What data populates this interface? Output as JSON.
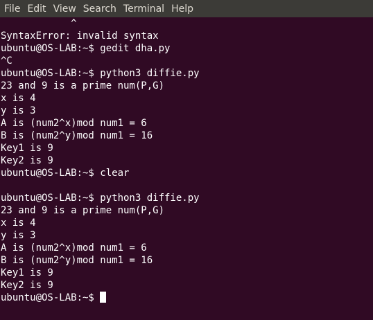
{
  "menu": [
    "File",
    "Edit",
    "View",
    "Search",
    "Terminal",
    "Help"
  ],
  "terminal": {
    "lines": [
      "            ^",
      "SyntaxError: invalid syntax",
      "ubuntu@OS-LAB:~$ gedit dha.py",
      "^C",
      "ubuntu@OS-LAB:~$ python3 diffie.py",
      "23 and 9 is a prime num(P,G)",
      "x is 4",
      "y is 3",
      "A is (num2^x)mod num1 = 6",
      "B is (num2^y)mod num1 = 16",
      "Key1 is 9",
      "Key2 is 9",
      "ubuntu@OS-LAB:~$ clear",
      "",
      "ubuntu@OS-LAB:~$ python3 diffie.py",
      "23 and 9 is a prime num(P,G)",
      "x is 4",
      "y is 3",
      "A is (num2^x)mod num1 = 6",
      "B is (num2^y)mod num1 = 16",
      "Key1 is 9",
      "Key2 is 9"
    ],
    "prompt": "ubuntu@OS-LAB:~$ "
  }
}
